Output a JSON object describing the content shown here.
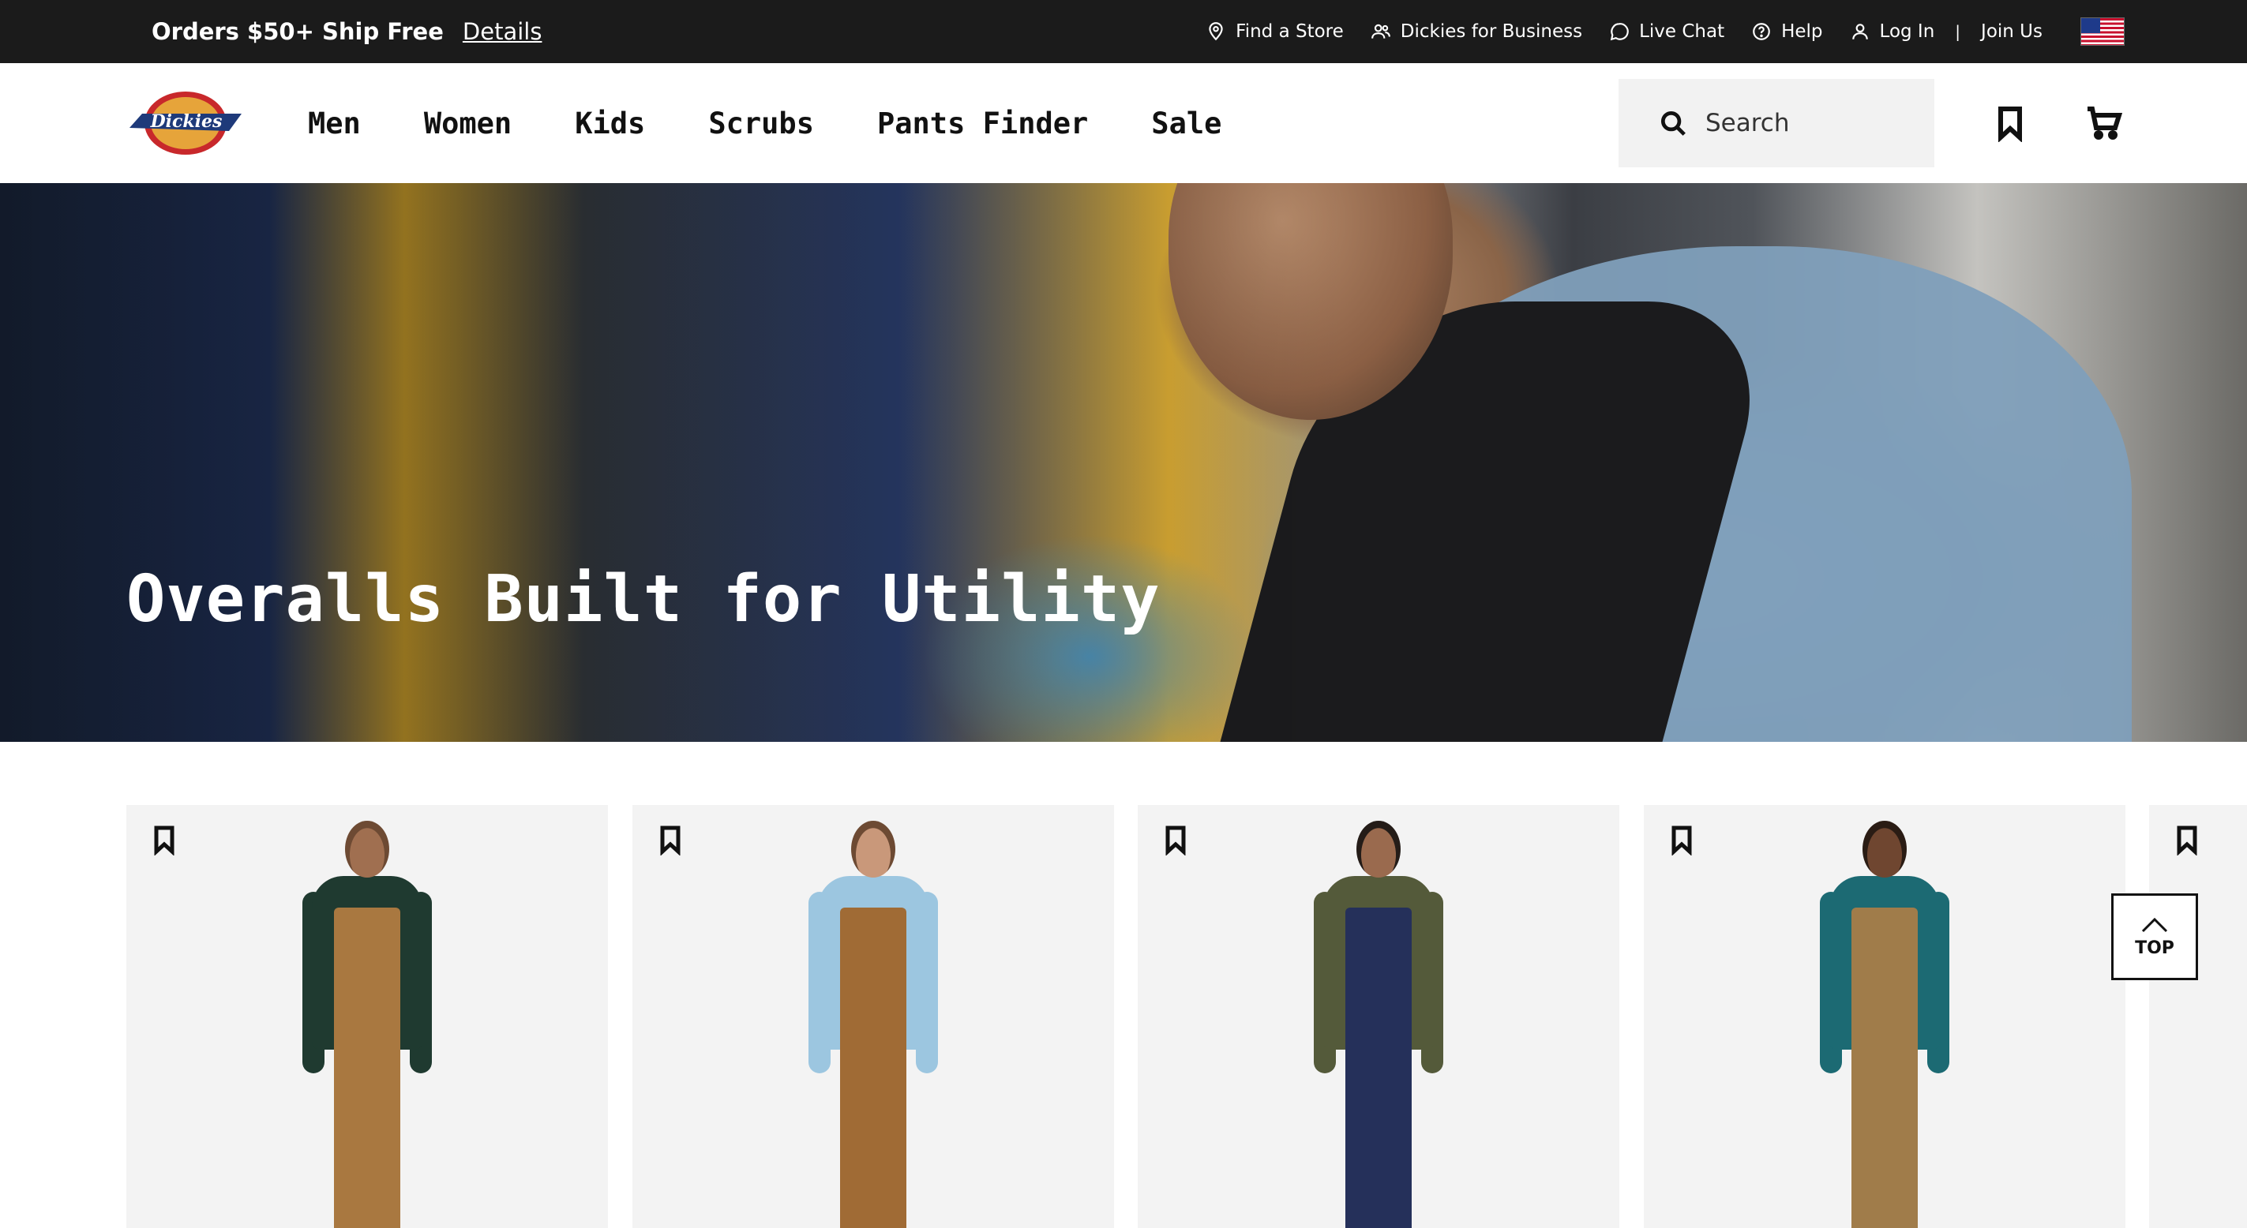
{
  "utility_bar": {
    "promo_text": "Orders $50+ Ship Free",
    "promo_link": "Details",
    "links": {
      "find_store": "Find a Store",
      "business": "Dickies for Business",
      "live_chat": "Live Chat",
      "help": "Help",
      "log_in": "Log In",
      "separator": "|",
      "join_us": "Join Us"
    }
  },
  "nav": {
    "logo_text": "Dickies",
    "links": [
      "Men",
      "Women",
      "Kids",
      "Scrubs",
      "Pants Finder",
      "Sale"
    ],
    "search_placeholder": "Search"
  },
  "hero": {
    "title": "Overalls Built for Utility"
  },
  "products": [
    {
      "shirt_color": "#1f3a30",
      "overall_color": "#a97840",
      "skin": "#a06f50",
      "hair": "#6d4a33"
    },
    {
      "shirt_color": "#9cc6e0",
      "overall_color": "#a06b35",
      "skin": "#c9987a",
      "hair": "#6d4a33"
    },
    {
      "shirt_color": "#545a3a",
      "overall_color": "#25305a",
      "skin": "#9a6a4e",
      "hair": "#241c18"
    },
    {
      "shirt_color": "#1c6a73",
      "overall_color": "#a07c4a",
      "skin": "#6f4630",
      "hair": "#2a1c14"
    }
  ],
  "back_to_top": "TOP",
  "colors": {
    "utility_bar_bg": "#1b1b1b",
    "search_bg": "#f2f2f2",
    "card_bg": "#f3f3f3",
    "logo_red": "#c8282b",
    "logo_navy": "#1e3a7a"
  }
}
